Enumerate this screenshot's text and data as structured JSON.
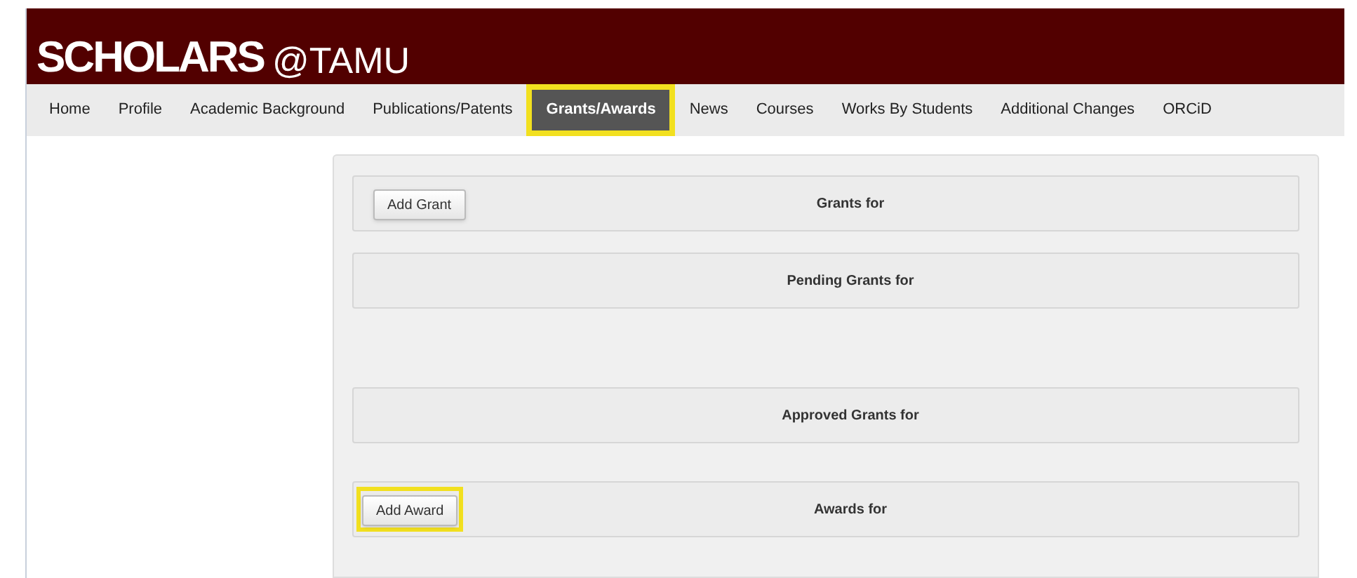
{
  "logo": {
    "main": "SCHOLARS",
    "suffix": "@TAMU"
  },
  "nav": [
    {
      "label": "Home",
      "selected": false,
      "highlighted": false
    },
    {
      "label": "Profile",
      "selected": false,
      "highlighted": false
    },
    {
      "label": "Academic Background",
      "selected": false,
      "highlighted": false
    },
    {
      "label": "Publications/Patents",
      "selected": false,
      "highlighted": false
    },
    {
      "label": "Grants/Awards",
      "selected": true,
      "highlighted": true
    },
    {
      "label": "News",
      "selected": false,
      "highlighted": false
    },
    {
      "label": "Courses",
      "selected": false,
      "highlighted": false
    },
    {
      "label": "Works By Students",
      "selected": false,
      "highlighted": false
    },
    {
      "label": "Additional Changes",
      "selected": false,
      "highlighted": false
    },
    {
      "label": "ORCiD",
      "selected": false,
      "highlighted": false
    }
  ],
  "sections": [
    {
      "title": "Grants for",
      "button": {
        "label": "Add Grant",
        "highlighted": false
      }
    },
    {
      "title": "Pending Grants for"
    },
    {
      "title": "Approved Grants for"
    },
    {
      "title": "Awards for",
      "button": {
        "label": "Add Award",
        "highlighted": true
      }
    }
  ]
}
